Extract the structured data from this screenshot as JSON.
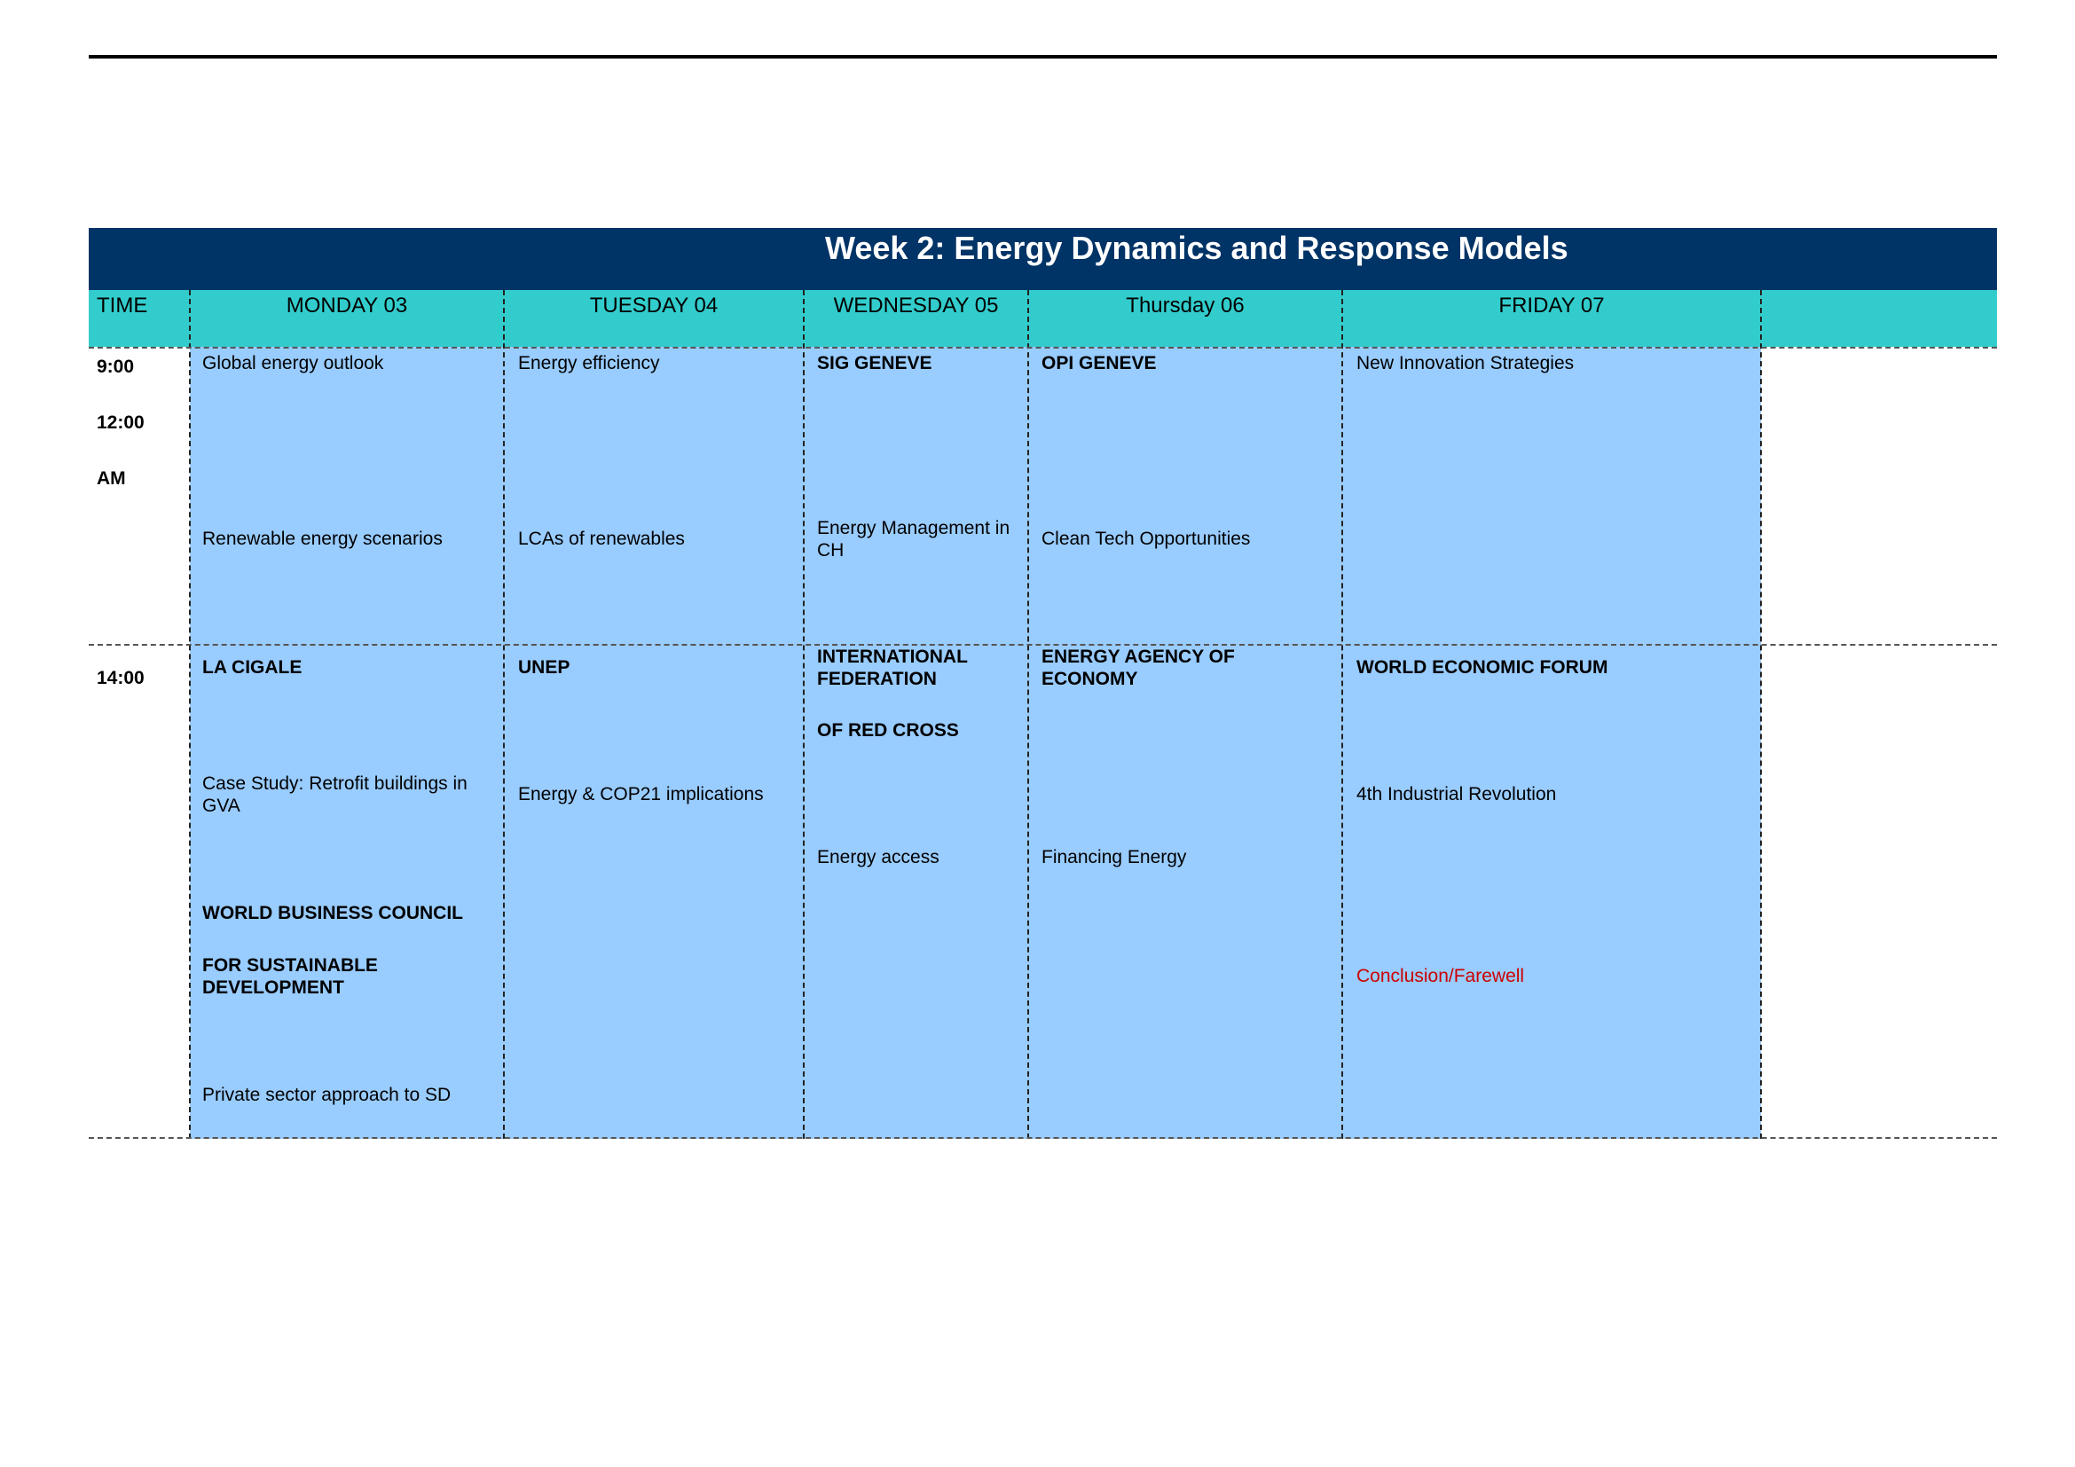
{
  "title": "Week 2: Energy Dynamics and Response Models",
  "header": {
    "time": "TIME",
    "days": [
      "MONDAY 03",
      "TUESDAY 04",
      "WEDNESDAY 05",
      "Thursday 06",
      "FRIDAY 07"
    ]
  },
  "times": {
    "morning": [
      "9:00",
      "12:00",
      "AM"
    ],
    "afternoon": "14:00"
  },
  "morning": {
    "monday": {
      "top": "Global energy outlook",
      "bottom": "Renewable energy scenarios"
    },
    "tuesday": {
      "top": "Energy efficiency",
      "bottom": "LCAs of renewables"
    },
    "wednesday": {
      "top": "SIG GENEVE",
      "bottom": "Energy Management in CH"
    },
    "thursday": {
      "top": "OPI GENEVE",
      "bottom": "Clean Tech Opportunities"
    },
    "friday": {
      "top": "New Innovation Strategies"
    }
  },
  "afternoon": {
    "monday": {
      "host1": "LA CIGALE",
      "topic1": "Case Study: Retrofit buildings in GVA",
      "host2a": "WORLD BUSINESS COUNCIL",
      "host2b": "FOR SUSTAINABLE DEVELOPMENT",
      "topic2": "Private sector approach to SD"
    },
    "tuesday": {
      "host": "UNEP",
      "topic": "Energy & COP21 implications"
    },
    "wednesday": {
      "host_a": "INTERNATIONAL FEDERATION",
      "host_b": "OF RED CROSS",
      "topic": "Energy access"
    },
    "thursday": {
      "host": "ENERGY AGENCY OF ECONOMY",
      "topic": "Financing Energy"
    },
    "friday": {
      "host": "WORLD ECONOMIC FORUM",
      "topic": "4th Industrial Revolution",
      "closing": "Conclusion/Farewell"
    }
  },
  "colors": {
    "title_bar": "#003366",
    "header_row": "#33cccc",
    "day_cells": "#99ccff",
    "closing_text": "#cc0000"
  }
}
